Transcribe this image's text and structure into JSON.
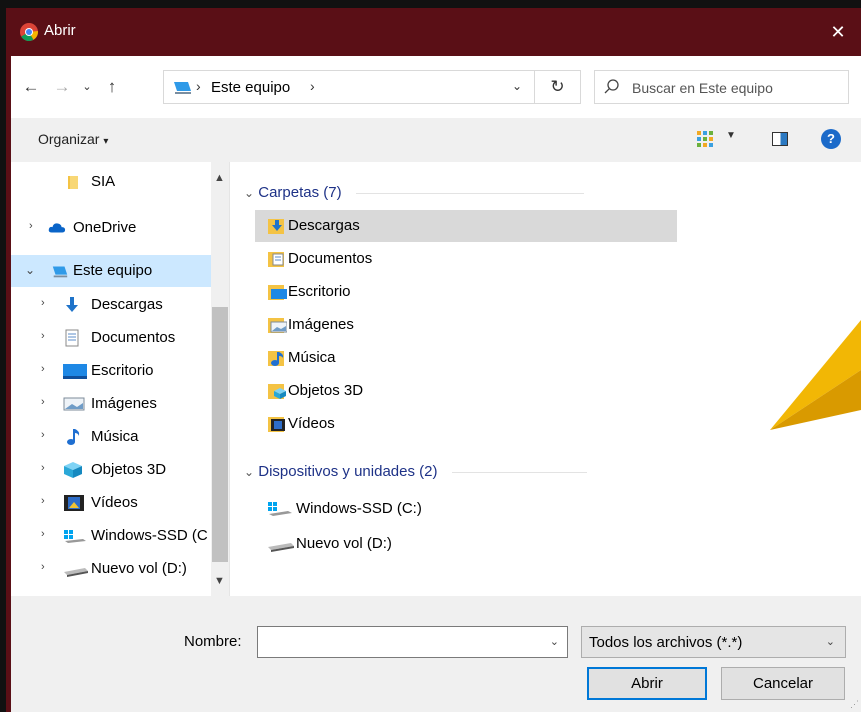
{
  "window": {
    "title": "Abrir"
  },
  "address": {
    "location": "Este equipo"
  },
  "search": {
    "placeholder": "Buscar en Este equipo"
  },
  "toolbar": {
    "organize_label": "Organizar"
  },
  "sidebar": {
    "items": [
      {
        "label": "SIA",
        "icon": "folder-icon"
      },
      {
        "label": "OneDrive",
        "icon": "cloud-icon"
      },
      {
        "label": "Este equipo",
        "icon": "computer-icon"
      },
      {
        "label": "Descargas",
        "icon": "download-icon"
      },
      {
        "label": "Documentos",
        "icon": "document-icon"
      },
      {
        "label": "Escritorio",
        "icon": "desktop-icon"
      },
      {
        "label": "Imágenes",
        "icon": "image-icon"
      },
      {
        "label": "Música",
        "icon": "music-icon"
      },
      {
        "label": "Objetos 3D",
        "icon": "cube-icon"
      },
      {
        "label": "Vídeos",
        "icon": "video-icon"
      },
      {
        "label": "Windows-SSD (C",
        "icon": "windows-drive-icon"
      },
      {
        "label": "Nuevo vol (D:)",
        "icon": "drive-icon"
      }
    ]
  },
  "content": {
    "groups": [
      {
        "header": "Carpetas (7)"
      },
      {
        "header": "Dispositivos y unidades (2)"
      }
    ],
    "folders": [
      {
        "label": "Descargas"
      },
      {
        "label": "Documentos"
      },
      {
        "label": "Escritorio"
      },
      {
        "label": "Imágenes"
      },
      {
        "label": "Música"
      },
      {
        "label": "Objetos 3D"
      },
      {
        "label": "Vídeos"
      }
    ],
    "drives": [
      {
        "label": "Windows-SSD (C:)"
      },
      {
        "label": "Nuevo vol (D:)"
      }
    ]
  },
  "footer": {
    "filename_label": "Nombre:",
    "filename_value": "",
    "filetype": "Todos los archivos (*.*)",
    "open_label": "Abrir",
    "cancel_label": "Cancelar"
  },
  "colors": {
    "titlebar": "#5a0f16",
    "selection": "#cce8ff",
    "hover": "#d9d9d9",
    "group_header": "#1e3287",
    "accent": "#0078d7"
  }
}
